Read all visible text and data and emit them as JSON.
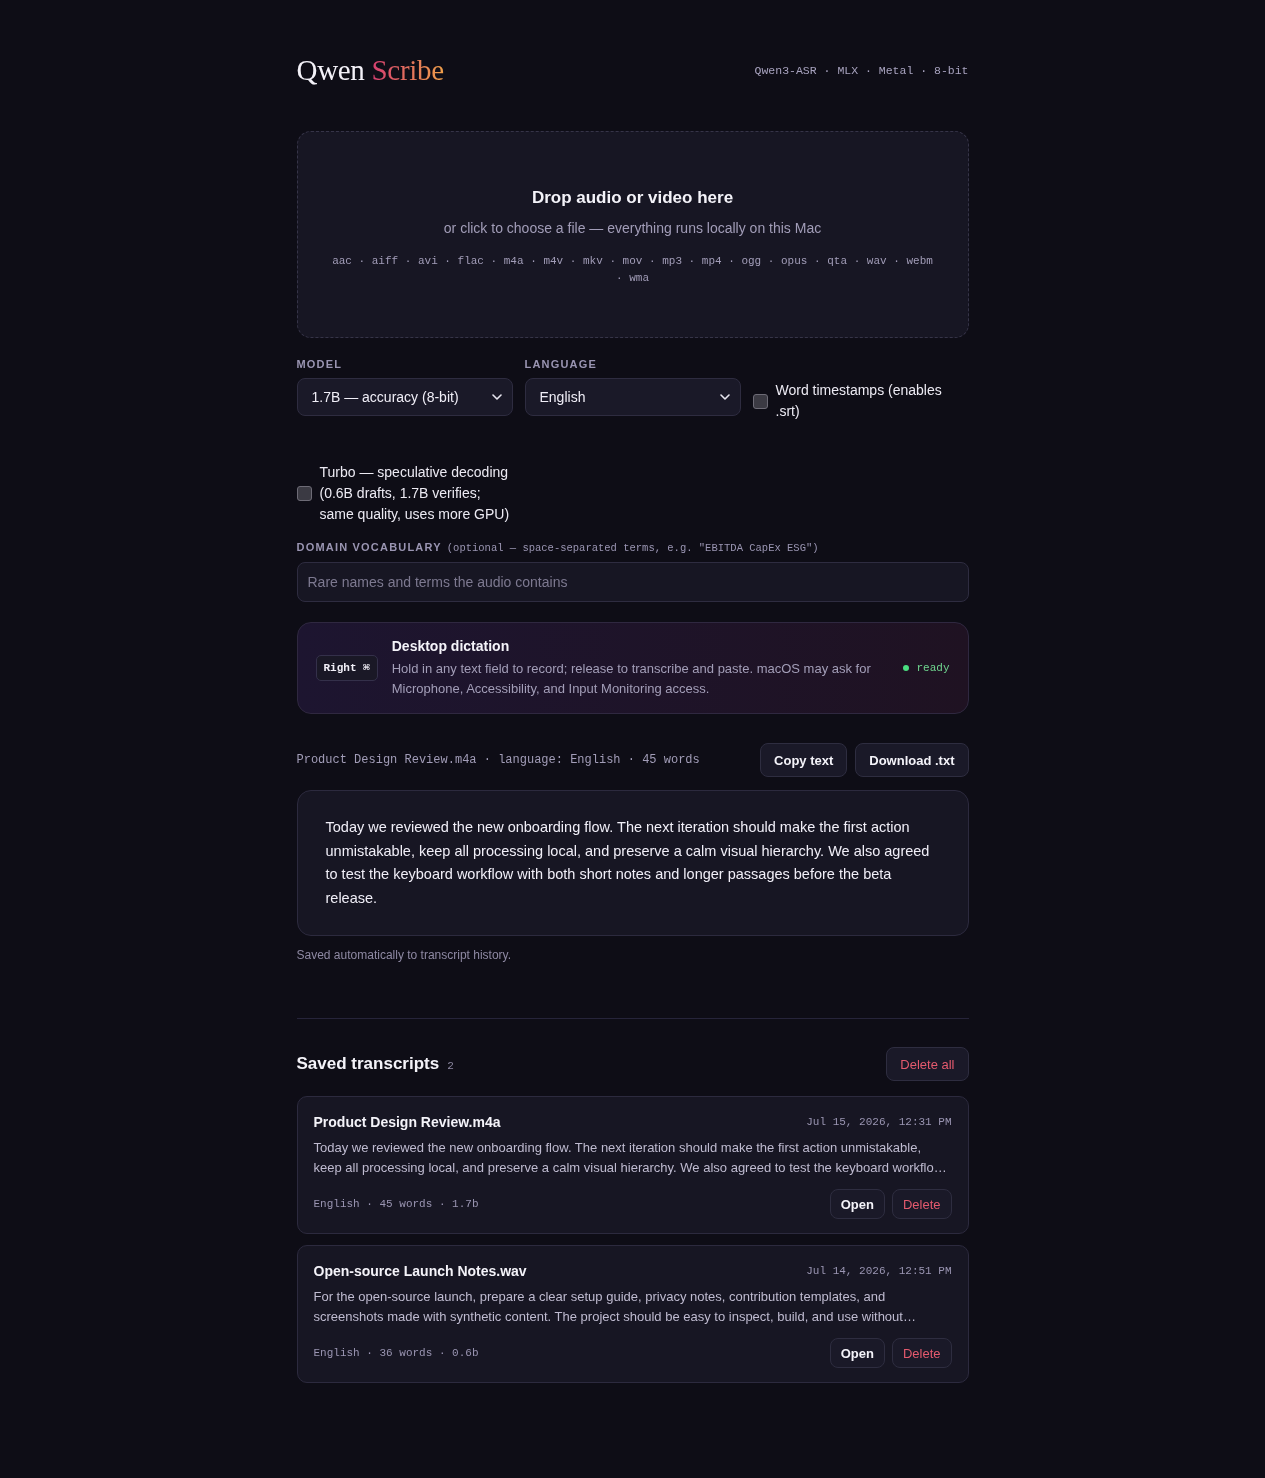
{
  "header": {
    "logo": "Qwen",
    "logo_accent": "Scribe",
    "meta": "Qwen3-ASR · MLX · Metal · 8-bit"
  },
  "dropzone": {
    "title": "Drop audio or video here",
    "subtitle": "or click to choose a file — everything runs locally on this Mac",
    "formats": "aac · aiff · avi · flac · m4a · m4v · mkv · mov · mp3 · mp4 · ogg · opus · qta · wav · webm · wma"
  },
  "settings": {
    "selects": [
      {
        "label": "MODEL",
        "value": "1.7B — accuracy (8-bit)"
      },
      {
        "label": "LANGUAGE",
        "value": "English"
      }
    ],
    "options": [
      {
        "label": "Word timestamps (enables .srt)",
        "checked": false
      },
      {
        "label": "Turbo — speculative decoding (0.6B drafts, 1.7B verifies; same quality, uses more GPU)",
        "checked": false
      }
    ]
  },
  "vocabulary": {
    "label": "DOMAIN VOCABULARY",
    "hint": "(optional — space-separated terms, e.g. \"EBITDA CapEx ESG\")",
    "placeholder": "Rare names and terms the audio contains"
  },
  "dictation": {
    "shortcut": "Right ⌘",
    "title": "Desktop dictation",
    "description": "Hold in any text field to record; release to transcribe and paste. macOS may ask for Microphone, Accessibility, and Input Monitoring access.",
    "status": "ready"
  },
  "result": {
    "meta": "Product Design Review.m4a · language: English · 45 words",
    "actions": [
      {
        "label": "Copy text",
        "kind": "default"
      },
      {
        "label": "Download .txt",
        "kind": "default"
      }
    ],
    "text": "Today we reviewed the new onboarding flow. The next iteration should make the first action unmistakable, keep all processing local, and preserve a calm visual hierarchy. We also agreed to test the keyboard workflow with both short notes and longer passages before the beta release.",
    "note": "Saved automatically to transcript history."
  },
  "history": {
    "title": "Saved transcripts",
    "count": "2",
    "action": {
      "label": "Delete all",
      "kind": "danger"
    },
    "items": [
      {
        "name": "Product Design Review.m4a",
        "date": "Jul 15, 2026, 12:31 PM",
        "preview": "Today we reviewed the new onboarding flow. The next iteration should make the first action unmistakable, keep all processing local, and preserve a calm visual hierarchy. We also agreed to test the keyboard workflo…",
        "meta": "English · 45 words · 1.7b",
        "actions": [
          {
            "label": "Open",
            "kind": "default"
          },
          {
            "label": "Delete",
            "kind": "danger"
          }
        ]
      },
      {
        "name": "Open-source Launch Notes.wav",
        "date": "Jul 14, 2026, 12:51 PM",
        "preview": "For the open-source launch, prepare a clear setup guide, privacy notes, contribution templates, and screenshots made with synthetic content. The project should be easy to inspect, build, and use without…",
        "meta": "English · 36 words · 0.6b",
        "actions": [
          {
            "label": "Open",
            "kind": "default"
          },
          {
            "label": "Delete",
            "kind": "danger"
          }
        ]
      }
    ]
  }
}
